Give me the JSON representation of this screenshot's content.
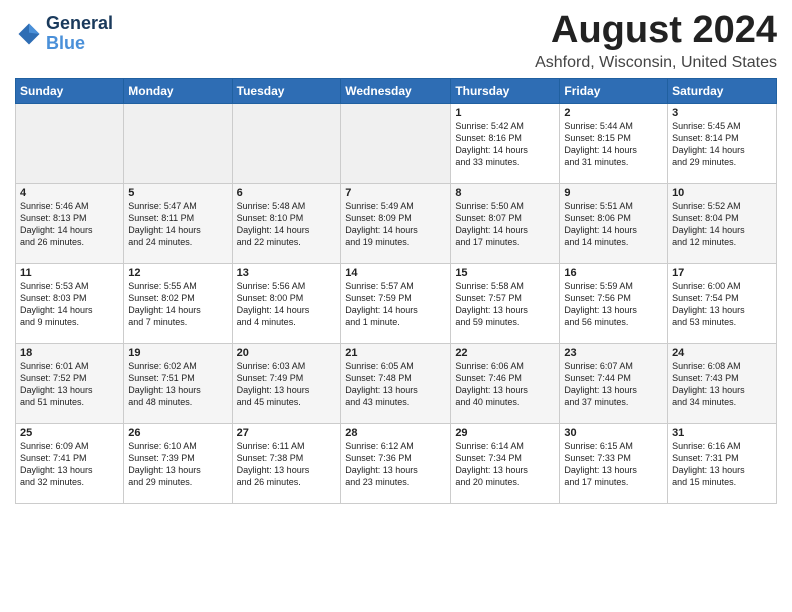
{
  "header": {
    "logo_line1": "General",
    "logo_line2": "Blue",
    "month_year": "August 2024",
    "location": "Ashford, Wisconsin, United States"
  },
  "weekdays": [
    "Sunday",
    "Monday",
    "Tuesday",
    "Wednesday",
    "Thursday",
    "Friday",
    "Saturday"
  ],
  "weeks": [
    [
      {
        "day": "",
        "info": ""
      },
      {
        "day": "",
        "info": ""
      },
      {
        "day": "",
        "info": ""
      },
      {
        "day": "",
        "info": ""
      },
      {
        "day": "1",
        "info": "Sunrise: 5:42 AM\nSunset: 8:16 PM\nDaylight: 14 hours\nand 33 minutes."
      },
      {
        "day": "2",
        "info": "Sunrise: 5:44 AM\nSunset: 8:15 PM\nDaylight: 14 hours\nand 31 minutes."
      },
      {
        "day": "3",
        "info": "Sunrise: 5:45 AM\nSunset: 8:14 PM\nDaylight: 14 hours\nand 29 minutes."
      }
    ],
    [
      {
        "day": "4",
        "info": "Sunrise: 5:46 AM\nSunset: 8:13 PM\nDaylight: 14 hours\nand 26 minutes."
      },
      {
        "day": "5",
        "info": "Sunrise: 5:47 AM\nSunset: 8:11 PM\nDaylight: 14 hours\nand 24 minutes."
      },
      {
        "day": "6",
        "info": "Sunrise: 5:48 AM\nSunset: 8:10 PM\nDaylight: 14 hours\nand 22 minutes."
      },
      {
        "day": "7",
        "info": "Sunrise: 5:49 AM\nSunset: 8:09 PM\nDaylight: 14 hours\nand 19 minutes."
      },
      {
        "day": "8",
        "info": "Sunrise: 5:50 AM\nSunset: 8:07 PM\nDaylight: 14 hours\nand 17 minutes."
      },
      {
        "day": "9",
        "info": "Sunrise: 5:51 AM\nSunset: 8:06 PM\nDaylight: 14 hours\nand 14 minutes."
      },
      {
        "day": "10",
        "info": "Sunrise: 5:52 AM\nSunset: 8:04 PM\nDaylight: 14 hours\nand 12 minutes."
      }
    ],
    [
      {
        "day": "11",
        "info": "Sunrise: 5:53 AM\nSunset: 8:03 PM\nDaylight: 14 hours\nand 9 minutes."
      },
      {
        "day": "12",
        "info": "Sunrise: 5:55 AM\nSunset: 8:02 PM\nDaylight: 14 hours\nand 7 minutes."
      },
      {
        "day": "13",
        "info": "Sunrise: 5:56 AM\nSunset: 8:00 PM\nDaylight: 14 hours\nand 4 minutes."
      },
      {
        "day": "14",
        "info": "Sunrise: 5:57 AM\nSunset: 7:59 PM\nDaylight: 14 hours\nand 1 minute."
      },
      {
        "day": "15",
        "info": "Sunrise: 5:58 AM\nSunset: 7:57 PM\nDaylight: 13 hours\nand 59 minutes."
      },
      {
        "day": "16",
        "info": "Sunrise: 5:59 AM\nSunset: 7:56 PM\nDaylight: 13 hours\nand 56 minutes."
      },
      {
        "day": "17",
        "info": "Sunrise: 6:00 AM\nSunset: 7:54 PM\nDaylight: 13 hours\nand 53 minutes."
      }
    ],
    [
      {
        "day": "18",
        "info": "Sunrise: 6:01 AM\nSunset: 7:52 PM\nDaylight: 13 hours\nand 51 minutes."
      },
      {
        "day": "19",
        "info": "Sunrise: 6:02 AM\nSunset: 7:51 PM\nDaylight: 13 hours\nand 48 minutes."
      },
      {
        "day": "20",
        "info": "Sunrise: 6:03 AM\nSunset: 7:49 PM\nDaylight: 13 hours\nand 45 minutes."
      },
      {
        "day": "21",
        "info": "Sunrise: 6:05 AM\nSunset: 7:48 PM\nDaylight: 13 hours\nand 43 minutes."
      },
      {
        "day": "22",
        "info": "Sunrise: 6:06 AM\nSunset: 7:46 PM\nDaylight: 13 hours\nand 40 minutes."
      },
      {
        "day": "23",
        "info": "Sunrise: 6:07 AM\nSunset: 7:44 PM\nDaylight: 13 hours\nand 37 minutes."
      },
      {
        "day": "24",
        "info": "Sunrise: 6:08 AM\nSunset: 7:43 PM\nDaylight: 13 hours\nand 34 minutes."
      }
    ],
    [
      {
        "day": "25",
        "info": "Sunrise: 6:09 AM\nSunset: 7:41 PM\nDaylight: 13 hours\nand 32 minutes."
      },
      {
        "day": "26",
        "info": "Sunrise: 6:10 AM\nSunset: 7:39 PM\nDaylight: 13 hours\nand 29 minutes."
      },
      {
        "day": "27",
        "info": "Sunrise: 6:11 AM\nSunset: 7:38 PM\nDaylight: 13 hours\nand 26 minutes."
      },
      {
        "day": "28",
        "info": "Sunrise: 6:12 AM\nSunset: 7:36 PM\nDaylight: 13 hours\nand 23 minutes."
      },
      {
        "day": "29",
        "info": "Sunrise: 6:14 AM\nSunset: 7:34 PM\nDaylight: 13 hours\nand 20 minutes."
      },
      {
        "day": "30",
        "info": "Sunrise: 6:15 AM\nSunset: 7:33 PM\nDaylight: 13 hours\nand 17 minutes."
      },
      {
        "day": "31",
        "info": "Sunrise: 6:16 AM\nSunset: 7:31 PM\nDaylight: 13 hours\nand 15 minutes."
      }
    ]
  ]
}
